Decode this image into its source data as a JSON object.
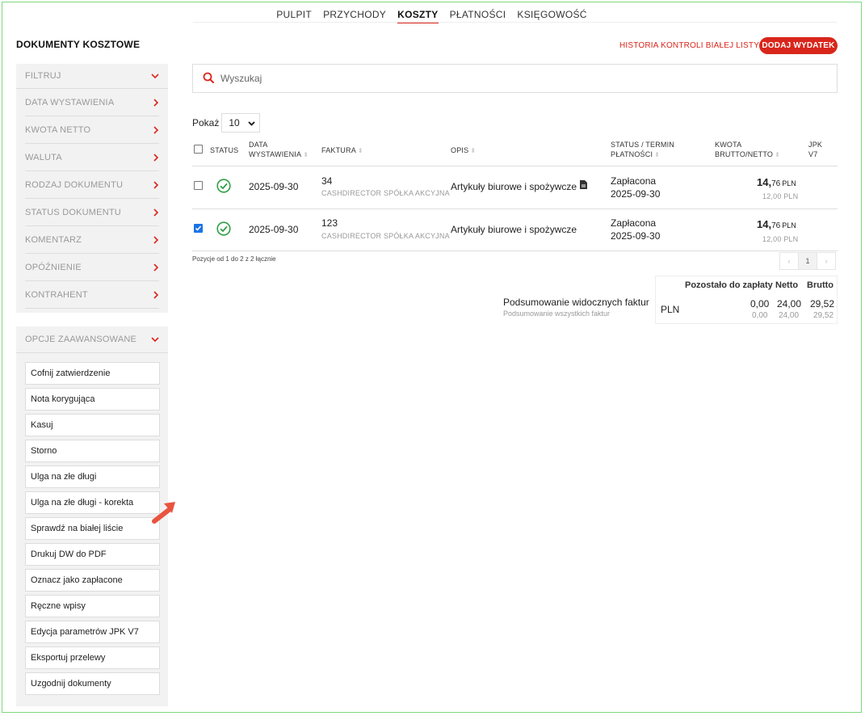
{
  "nav": {
    "items": [
      "PULPIT",
      "PRZYCHODY",
      "KOSZTY",
      "PŁATNOŚCI",
      "KSIĘGOWOŚĆ"
    ],
    "active": "KOSZTY"
  },
  "page": {
    "title": "DOKUMENTY KOSZTOWE",
    "history_link": "HISTORIA KONTROLI BIAŁEJ LISTY",
    "add_button": "DODAJ WYDATEK"
  },
  "filters": {
    "header": "FILTRUJ",
    "items": [
      "DATA WYSTAWIENIA",
      "KWOTA NETTO",
      "WALUTA",
      "RODZAJ DOKUMENTU",
      "STATUS DOKUMENTU",
      "KOMENTARZ",
      "OPÓŹNIENIE",
      "KONTRAHENT"
    ]
  },
  "advanced": {
    "header": "OPCJE ZAAWANSOWANE",
    "items": [
      "Cofnij zatwierdzenie",
      "Nota korygująca",
      "Kasuj",
      "Storno",
      "Ulga na złe długi",
      "Ulga na złe długi - korekta",
      "Sprawdź na białej liście",
      "Drukuj DW do PDF",
      "Oznacz jako zapłacone",
      "Ręczne wpisy",
      "Edycja parametrów JPK V7",
      "Eksportuj przelewy",
      "Uzgodnij dokumenty"
    ]
  },
  "search": {
    "placeholder": "Wyszukaj"
  },
  "show": {
    "label": "Pokaż",
    "value": "10"
  },
  "table": {
    "headers": {
      "status": "STATUS",
      "date_1": "DATA",
      "date_2": "WYSTAWIENIA",
      "invoice": "FAKTURA",
      "desc": "OPIS",
      "term_1": "STATUS / TERMIN",
      "term_2": "PŁATNOŚCI",
      "amount_1": "KWOTA",
      "amount_2": "BRUTTO/NETTO",
      "jpk_1": "JPK",
      "jpk_2": "V7"
    },
    "rows": [
      {
        "checked": false,
        "date": "2025-09-30",
        "invoice_no": "34",
        "company": "CASHDIRECTOR SPÓŁKA AKCYJNA",
        "desc": "Artykuły biurowe i spożywcze",
        "status": "Zapłacona",
        "due": "2025-09-30",
        "gross_int": "14,",
        "gross_dec": "76",
        "currency": "PLN",
        "net": "12,00 PLN"
      },
      {
        "checked": true,
        "date": "2025-09-30",
        "invoice_no": "123",
        "company": "CASHDIRECTOR SPÓŁKA AKCYJNA",
        "desc": "Artykuły biurowe i spożywcze",
        "status": "Zapłacona",
        "due": "2025-09-30",
        "gross_int": "14,",
        "gross_dec": "76",
        "currency": "PLN",
        "net": "12,00 PLN"
      }
    ]
  },
  "pagination": {
    "info": "Pozycje od 1 do 2 z 2 łącznie",
    "prev": "‹",
    "current": "1",
    "next": "›"
  },
  "summary": {
    "visible_label": "Podsumowanie widocznych faktur",
    "all_label": "Podsumowanie wszystkich faktur",
    "col_remaining": "Pozostało do zapłaty",
    "col_net": "Netto",
    "col_gross": "Brutto",
    "currency": "PLN",
    "visible": {
      "remaining": "0,00",
      "net": "24,00",
      "gross": "29,52"
    },
    "all": {
      "remaining": "0,00",
      "net": "24,00",
      "gross": "29,52"
    }
  },
  "colors": {
    "accent": "#d9261c",
    "success": "#2e9e44",
    "checkbox": "#1a73e8",
    "frame": "#7ed67e"
  }
}
